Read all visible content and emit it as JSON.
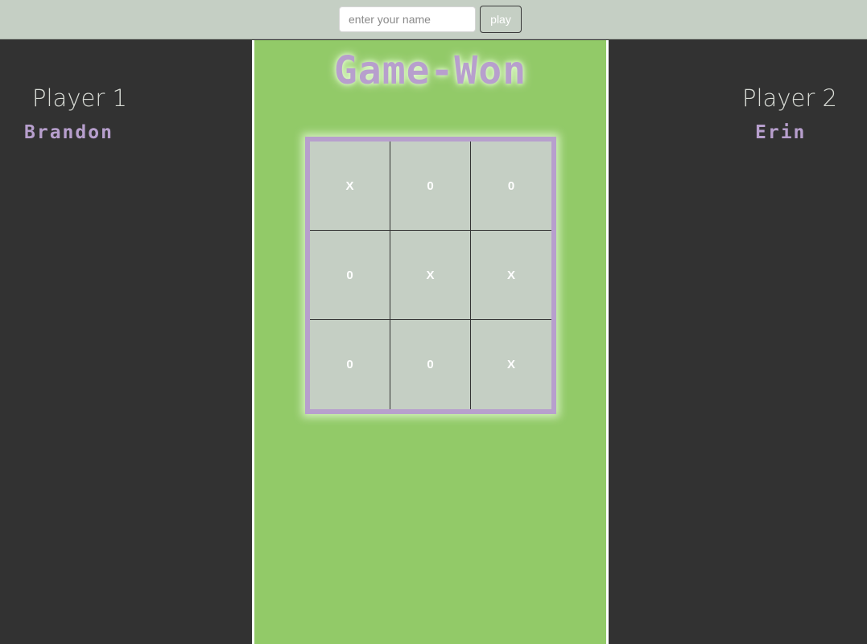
{
  "header": {
    "name_input": {
      "value": "",
      "placeholder": "enter your name"
    },
    "play_label": "play"
  },
  "players": [
    {
      "label": "Player 1",
      "name": "Brandon"
    },
    {
      "label": "Player 2",
      "name": "Erin"
    }
  ],
  "game": {
    "status": "Game-Won",
    "board": [
      "X",
      "0",
      "0",
      "0",
      "X",
      "X",
      "0",
      "0",
      "X"
    ]
  },
  "colors": {
    "topbar": "#c5cfc4",
    "side_panels": "#323232",
    "center_panel": "#92ca68",
    "accent": "#b79fcd",
    "board_bg": "#c5cfc4"
  }
}
